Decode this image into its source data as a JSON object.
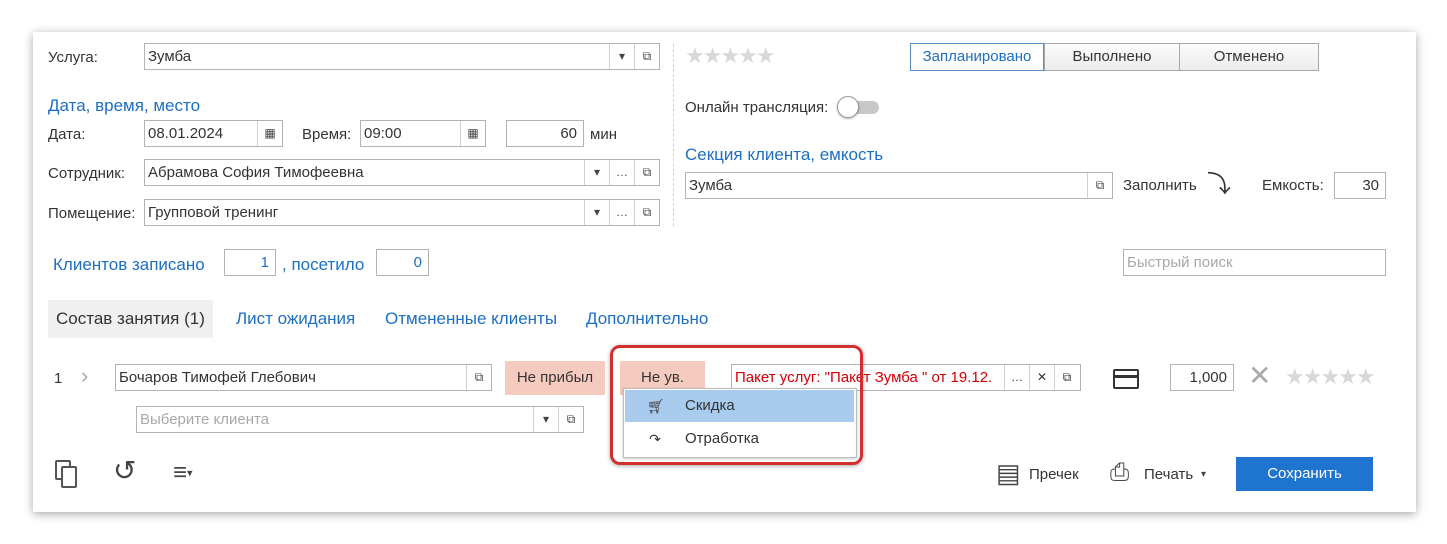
{
  "service": {
    "label": "Услуга:",
    "value": "Зумба"
  },
  "datetime": {
    "heading": "Дата, время, место",
    "date_label": "Дата:",
    "date_value": "08.01.2024",
    "time_label": "Время:",
    "time_value": "09:00",
    "duration_value": "60",
    "duration_unit": "мин"
  },
  "employee": {
    "label": "Сотрудник:",
    "value": "Абрамова София Тимофеевна"
  },
  "room": {
    "label": "Помещение:",
    "value": "Групповой тренинг"
  },
  "status": {
    "options": [
      "Запланировано",
      "Выполнено",
      "Отменено"
    ],
    "selected": "Запланировано"
  },
  "online": {
    "label": "Онлайн трансляция:",
    "on": false
  },
  "section": {
    "heading": "Секция клиента, емкость",
    "value": "Зумба",
    "fill_label": "Заполнить",
    "capacity_label": "Емкость:",
    "capacity_value": "30"
  },
  "counts": {
    "enrolled_label": "Клиентов записано",
    "enrolled_value": "1",
    "visited_label": ", посетило",
    "visited_value": "0"
  },
  "search": {
    "placeholder": "Быстрый поиск"
  },
  "tabs": [
    {
      "label": "Состав занятия (1)",
      "active": true
    },
    {
      "label": "Лист ожидания"
    },
    {
      "label": "Отмененные клиенты"
    },
    {
      "label": "Дополнительно"
    }
  ],
  "client_row": {
    "index": "1",
    "client_name": "Бочаров Тимофей Глебович",
    "not_arrived_label": "Не прибыл",
    "excused_label": "Не ув.",
    "package": "Пакет услуг: \"Пакет Зумба \" от 19.12.",
    "quantity": "1,000"
  },
  "new_client": {
    "placeholder": "Выберите клиента"
  },
  "dropdown_menu": {
    "items": [
      {
        "label": "Скидка",
        "icon": "cart-icon",
        "highlighted": true
      },
      {
        "label": "Отработка",
        "icon": "redo-arrow-icon"
      }
    ],
    "highlight_color": "#d32f2f"
  },
  "footer": {
    "receipt_label": "Пречек",
    "print_label": "Печать",
    "save_label": "Сохранить"
  },
  "colors": {
    "accent": "#1c6fc2",
    "save_button": "#1f74cf",
    "pink_button": "#f6cbbf",
    "package_text": "#d00000",
    "menu_highlight": "#a8cbee"
  }
}
